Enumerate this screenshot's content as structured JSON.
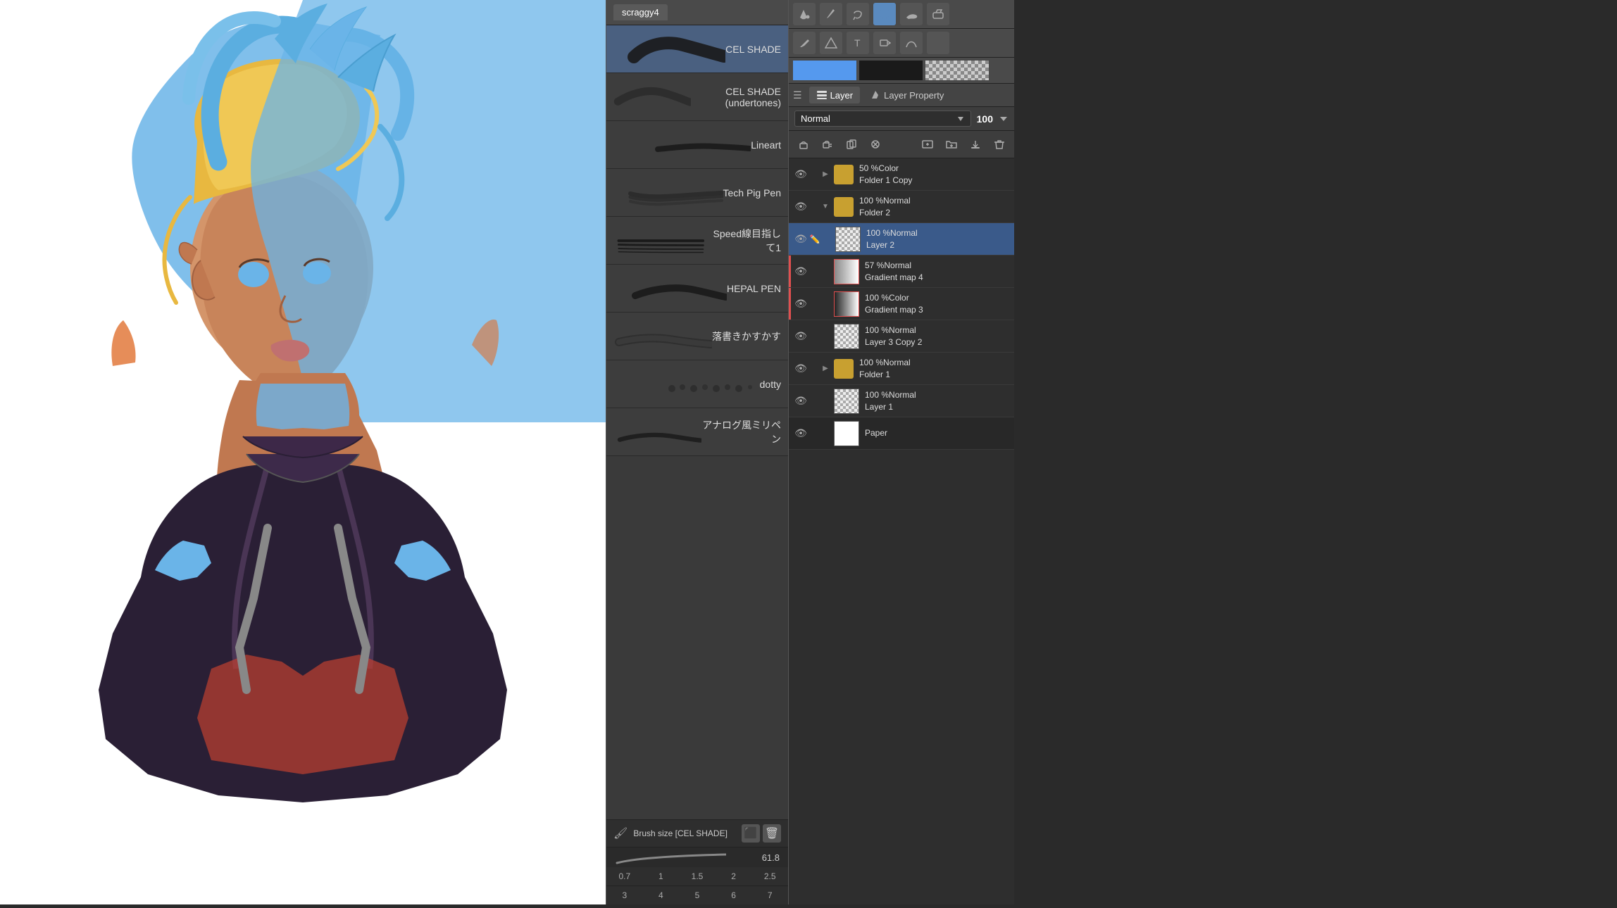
{
  "app": {
    "title": "scraggy4",
    "tab_label": "scraggy4"
  },
  "tools": {
    "top_row": [
      "bucket",
      "brush",
      "lasso",
      "stamp",
      "smudge",
      "eraser"
    ],
    "second_row": [
      "pen",
      "triangle",
      "text",
      "transform",
      "curve",
      "gradient"
    ]
  },
  "color_swatches": {
    "blue": "#5599ee",
    "dark": "#1a1a1a",
    "checker": "transparent"
  },
  "layer_panel": {
    "tabs": [
      {
        "label": "Layer",
        "icon": "layers",
        "active": true
      },
      {
        "label": "Layer Property",
        "icon": "pen",
        "active": false
      }
    ],
    "blend_mode": "Normal",
    "opacity": 100,
    "layers": [
      {
        "id": "folder-50",
        "type": "folder",
        "visible": true,
        "name": "50 %Color\nFolder 1 Copy",
        "blend": "50 %Color",
        "expanded": false,
        "selected": false,
        "red_indicator": false
      },
      {
        "id": "folder-100-2",
        "type": "folder",
        "visible": true,
        "name": "100 %Normal\nFolder 2",
        "blend": "100 %Normal",
        "expanded": true,
        "selected": false,
        "red_indicator": false
      },
      {
        "id": "layer-2",
        "type": "layer",
        "visible": true,
        "name": "100 %Normal\nLayer 2",
        "blend": "100 %Normal",
        "thumb": "checker",
        "selected": true,
        "red_indicator": false,
        "has_pen": true
      },
      {
        "id": "gradient-4",
        "type": "layer",
        "visible": true,
        "name": "57 %Normal\nGradient map 4",
        "blend": "57 %Normal",
        "thumb": "gradient",
        "selected": false,
        "red_indicator": true
      },
      {
        "id": "gradient-3",
        "type": "layer",
        "visible": true,
        "name": "100 %Color\nGradient map 3",
        "blend": "100 %Color",
        "thumb": "gradient",
        "selected": false,
        "red_indicator": true
      },
      {
        "id": "layer3copy2",
        "type": "layer",
        "visible": true,
        "name": "100 %Normal\nLayer 3 Copy 2",
        "blend": "100 %Normal",
        "thumb": "checker",
        "selected": false,
        "red_indicator": false
      },
      {
        "id": "folder-1",
        "type": "folder",
        "visible": true,
        "name": "100 %Normal\nFolder 1",
        "blend": "100 %Normal",
        "expanded": false,
        "selected": false,
        "red_indicator": false
      },
      {
        "id": "layer-1",
        "type": "layer",
        "visible": true,
        "name": "100 %Normal\nLayer 1",
        "blend": "100 %Normal",
        "thumb": "checker",
        "selected": false,
        "red_indicator": false
      },
      {
        "id": "paper",
        "type": "layer",
        "visible": true,
        "name": "Paper",
        "blend": "",
        "thumb": "white",
        "selected": false,
        "red_indicator": false
      }
    ]
  },
  "brushes": {
    "items": [
      {
        "name": "CEL SHADE",
        "selected": true
      },
      {
        "name": "CEL SHADE (undertones)",
        "selected": false
      },
      {
        "name": "Lineart",
        "selected": false
      },
      {
        "name": "Tech Pig Pen",
        "selected": false
      },
      {
        "name": "Speed線目指して1",
        "selected": false
      },
      {
        "name": "HEPAL PEN",
        "selected": false
      },
      {
        "name": "落書きかすかす",
        "selected": false
      },
      {
        "name": "dotty",
        "selected": false
      },
      {
        "name": "アナログ風ミリペン",
        "selected": false
      }
    ],
    "settings": {
      "label": "Brush size [CEL SHADE]",
      "size": "61.8"
    },
    "sizes": [
      "0.7",
      "1",
      "1.5",
      "2",
      "2.5",
      "3",
      "4",
      "5",
      "6",
      "7"
    ]
  }
}
